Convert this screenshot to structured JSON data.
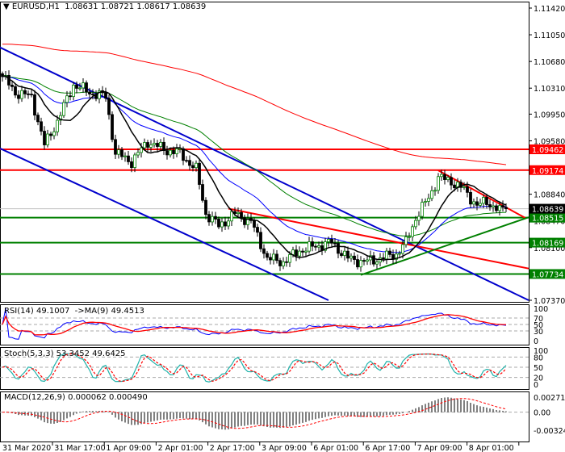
{
  "header": {
    "arrow": "▼",
    "symbol": "EURUSD,H1",
    "ohlc": "1.08631 1.08721 1.08617 1.08639"
  },
  "chart_data": {
    "type": "candlestick",
    "title": "EURUSD,H1",
    "ylim": [
      1.0737,
      1.1142
    ],
    "price_ticks": [
      "1.11420",
      "1.11050",
      "1.10680",
      "1.10310",
      "1.09950",
      "1.09580",
      "1.08840",
      "1.08470",
      "1.08100",
      "1.07370"
    ],
    "time_labels": [
      "31 Mar 2020",
      "31 Mar 17:00",
      "1 Apr 09:00",
      "2 Apr 01:00",
      "2 Apr 17:00",
      "3 Apr 09:00",
      "6 Apr 01:00",
      "6 Apr 17:00",
      "7 Apr 09:00",
      "8 Apr 01:00"
    ],
    "bars": 157,
    "close_keypoints": [
      [
        0,
        1.1047
      ],
      [
        4,
        1.1025
      ],
      [
        9,
        1.1019
      ],
      [
        13,
        1.0952
      ],
      [
        17,
        1.0985
      ],
      [
        22,
        1.1036
      ],
      [
        27,
        1.1025
      ],
      [
        32,
        1.1019
      ],
      [
        35,
        1.0941
      ],
      [
        40,
        1.0929
      ],
      [
        45,
        1.0957
      ],
      [
        50,
        1.0946
      ],
      [
        55,
        1.0941
      ],
      [
        60,
        1.0918
      ],
      [
        63,
        1.0857
      ],
      [
        67,
        1.084
      ],
      [
        72,
        1.0857
      ],
      [
        77,
        1.0846
      ],
      [
        82,
        1.0795
      ],
      [
        87,
        1.079
      ],
      [
        92,
        1.0806
      ],
      [
        97,
        1.0812
      ],
      [
        102,
        1.0817
      ],
      [
        107,
        1.0795
      ],
      [
        112,
        1.079
      ],
      [
        117,
        1.0795
      ],
      [
        122,
        1.0801
      ],
      [
        125,
        1.0817
      ],
      [
        128,
        1.0851
      ],
      [
        132,
        1.0879
      ],
      [
        135,
        1.0907
      ],
      [
        139,
        1.0902
      ],
      [
        143,
        1.089
      ],
      [
        147,
        1.0868
      ],
      [
        150,
        1.0874
      ],
      [
        154,
        1.0861
      ],
      [
        156,
        1.0864
      ]
    ],
    "levels": [
      {
        "price": 1.09462,
        "label": "1.09462",
        "color": "#ff0000"
      },
      {
        "price": 1.09174,
        "label": "1.09174",
        "color": "#ff0000"
      },
      {
        "price": 1.08515,
        "label": "1.08515",
        "color": "#008000"
      },
      {
        "price": 1.08169,
        "label": "1.08169",
        "color": "#008000"
      },
      {
        "price": 1.07734,
        "label": "1.07734",
        "color": "#008000"
      }
    ],
    "current": {
      "price": 1.08639,
      "label": "1.08639",
      "color": "#000000"
    },
    "trendlines": [
      {
        "name": "channel-upper",
        "color": "#0000cc",
        "from": [
          -1,
          1.1088
        ],
        "to": [
          163,
          1.0737
        ]
      },
      {
        "name": "channel-lower",
        "color": "#0000cc",
        "from": [
          -1,
          1.0948
        ],
        "to": [
          101,
          1.0737
        ]
      },
      {
        "name": "red-support",
        "color": "#ff0000",
        "from": [
          70,
          1.0864
        ],
        "to": [
          163,
          1.0781
        ]
      },
      {
        "name": "red-resistance",
        "color": "#ff0000",
        "from": [
          135,
          1.0917
        ],
        "to": [
          162,
          1.0851
        ]
      },
      {
        "name": "green-support",
        "color": "#008000",
        "from": [
          111,
          1.0772
        ],
        "to": [
          163,
          1.0852
        ]
      }
    ],
    "indicators": {
      "rsi": {
        "label": "RSI(14) 49.1007  ->MA(9) 49.4513",
        "ticks": [
          "100",
          "70",
          "50",
          "30",
          "0"
        ]
      },
      "stoch": {
        "label": "Stoch(5,3,3) 53.3452 49.6425",
        "ticks": [
          "100",
          "80",
          "50",
          "20",
          "0"
        ]
      },
      "macd": {
        "label": "MACD(12,26,9) 0.000062 0.000490",
        "ticks": [
          "0.002711",
          "0.00",
          "-0.003246"
        ],
        "range": [
          -0.003246,
          0.002711
        ]
      }
    }
  }
}
